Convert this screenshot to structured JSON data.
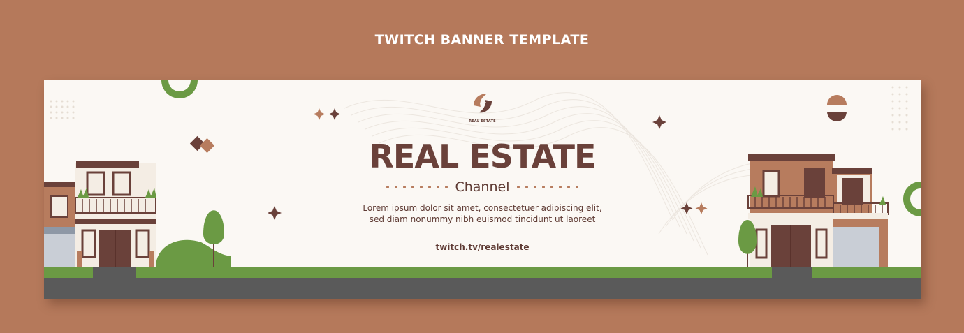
{
  "page_title": "TWITCH BANNER TEMPLATE",
  "banner": {
    "logo_text": "REAL ESTATE",
    "headline": "REAL ESTATE",
    "subtitle": "Channel",
    "body_line1": "Lorem ipsum dolor sit amet, consectetuer adipiscing elit,",
    "body_line2": "sed diam nonummy nibh euismod tincidunt ut laoreet",
    "url": "twitch.tv/realestate"
  },
  "colors": {
    "outer_background": "#b5795b",
    "banner_background": "#fbf8f4",
    "text_brown": "#6a413a",
    "accent_tan": "#b77c5e",
    "green": "#6b9a44",
    "road": "#5a5a5a"
  }
}
